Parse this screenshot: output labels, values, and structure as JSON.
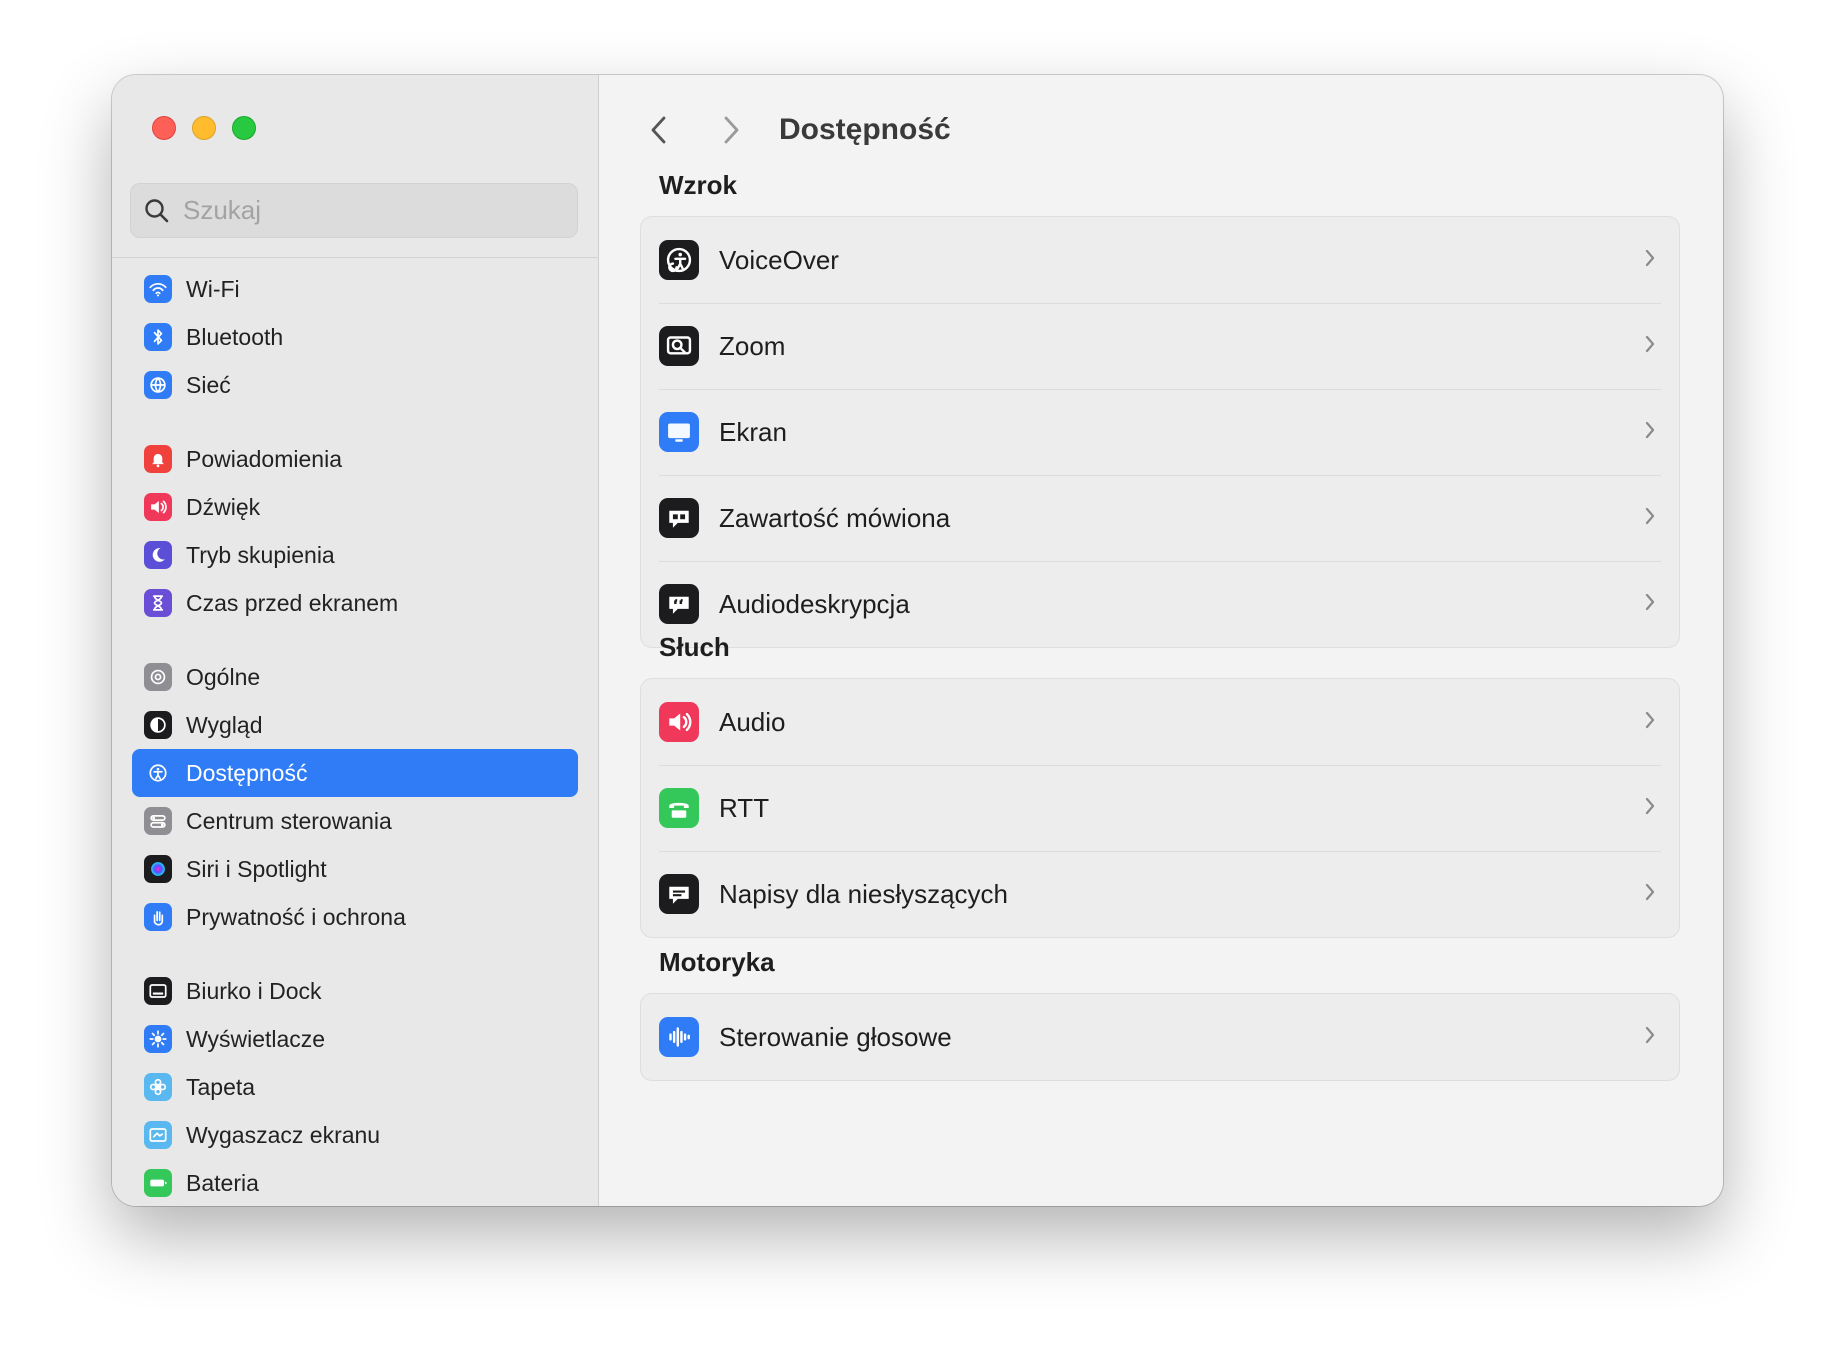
{
  "window": {
    "traffic_lights": [
      "close",
      "minimize",
      "zoom"
    ]
  },
  "search": {
    "placeholder": "Szukaj"
  },
  "sidebar": {
    "groups": [
      [
        {
          "label": "Wi-Fi",
          "icon": "wifi-icon",
          "color": "#2f7cf6"
        },
        {
          "label": "Bluetooth",
          "icon": "bluetooth-icon",
          "color": "#2f7cf6"
        },
        {
          "label": "Sieć",
          "icon": "globe-icon",
          "color": "#2f7cf6"
        }
      ],
      [
        {
          "label": "Powiadomienia",
          "icon": "bell-icon",
          "color": "#f0413d"
        },
        {
          "label": "Dźwięk",
          "icon": "speaker-icon",
          "color": "#f0385a"
        },
        {
          "label": "Tryb skupienia",
          "icon": "moon-icon",
          "color": "#5a4fd6"
        },
        {
          "label": "Czas przed ekranem",
          "icon": "hourglass-icon",
          "color": "#6a4fd6"
        }
      ],
      [
        {
          "label": "Ogólne",
          "icon": "gear-icon",
          "color": "#8e8e93"
        },
        {
          "label": "Wygląd",
          "icon": "appearance-icon",
          "color": "#1c1c1e"
        },
        {
          "label": "Dostępność",
          "icon": "accessibility-icon",
          "color": "#2f7cf6",
          "active": true
        },
        {
          "label": "Centrum sterowania",
          "icon": "toggles-icon",
          "color": "#8e8e93"
        },
        {
          "label": "Siri i Spotlight",
          "icon": "siri-icon",
          "color": "#1c1c1e"
        },
        {
          "label": "Prywatność i ochrona",
          "icon": "hand-icon",
          "color": "#2f7cf6"
        }
      ],
      [
        {
          "label": "Biurko i Dock",
          "icon": "dock-icon",
          "color": "#1c1c1e"
        },
        {
          "label": "Wyświetlacze",
          "icon": "sun-icon",
          "color": "#2f7cf6"
        },
        {
          "label": "Tapeta",
          "icon": "flower-icon",
          "color": "#5ab8f0"
        },
        {
          "label": "Wygaszacz ekranu",
          "icon": "screensaver-icon",
          "color": "#5ab8f0"
        },
        {
          "label": "Bateria",
          "icon": "battery-icon",
          "color": "#34c759"
        }
      ]
    ]
  },
  "main": {
    "title": "Dostępność",
    "sections": [
      {
        "title": "Wzrok",
        "rows": [
          {
            "label": "VoiceOver",
            "icon": "voiceover-icon",
            "color": "#1c1c1e"
          },
          {
            "label": "Zoom",
            "icon": "zoom-icon",
            "color": "#1c1c1e"
          },
          {
            "label": "Ekran",
            "icon": "display-icon",
            "color": "#2f7cf6"
          },
          {
            "label": "Zawartość mówiona",
            "icon": "spoken-content-icon",
            "color": "#1c1c1e"
          },
          {
            "label": "Audiodeskrypcja",
            "icon": "audio-description-icon",
            "color": "#1c1c1e"
          }
        ]
      },
      {
        "title": "Słuch",
        "rows": [
          {
            "label": "Audio",
            "icon": "speaker-icon",
            "color": "#f0385a"
          },
          {
            "label": "RTT",
            "icon": "tty-icon",
            "color": "#34c759"
          },
          {
            "label": "Napisy dla niesłyszących",
            "icon": "captions-icon",
            "color": "#1c1c1e"
          }
        ]
      },
      {
        "title": "Motoryka",
        "rows": [
          {
            "label": "Sterowanie głosowe",
            "icon": "waveform-icon",
            "color": "#2f7cf6"
          }
        ]
      }
    ]
  }
}
